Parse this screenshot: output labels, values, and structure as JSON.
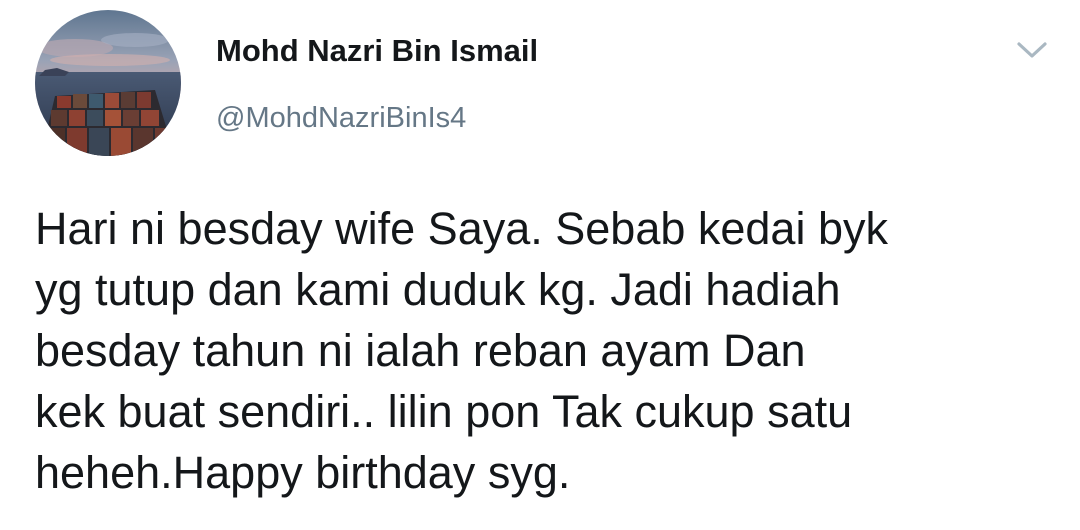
{
  "author": {
    "display_name": "Mohd Nazri Bin Ismail",
    "handle": "@MohdNazriBinIs4",
    "avatar_icon": "profile-photo-cargo-ship-at-sea"
  },
  "menu": {
    "icon": "chevron-down-icon"
  },
  "tweet": {
    "lines": [
      "Hari ni besday wife Saya. Sebab kedai byk",
      "yg tutup dan kami duduk kg. Jadi hadiah",
      "besday tahun ni ialah reban ayam Dan",
      "kek buat sendiri.. lilin pon Tak cukup satu",
      "heheh.Happy birthday syg."
    ]
  },
  "colors": {
    "text_primary": "#14171a",
    "text_secondary": "#657786",
    "chevron": "#aab8c2",
    "background": "#ffffff"
  }
}
